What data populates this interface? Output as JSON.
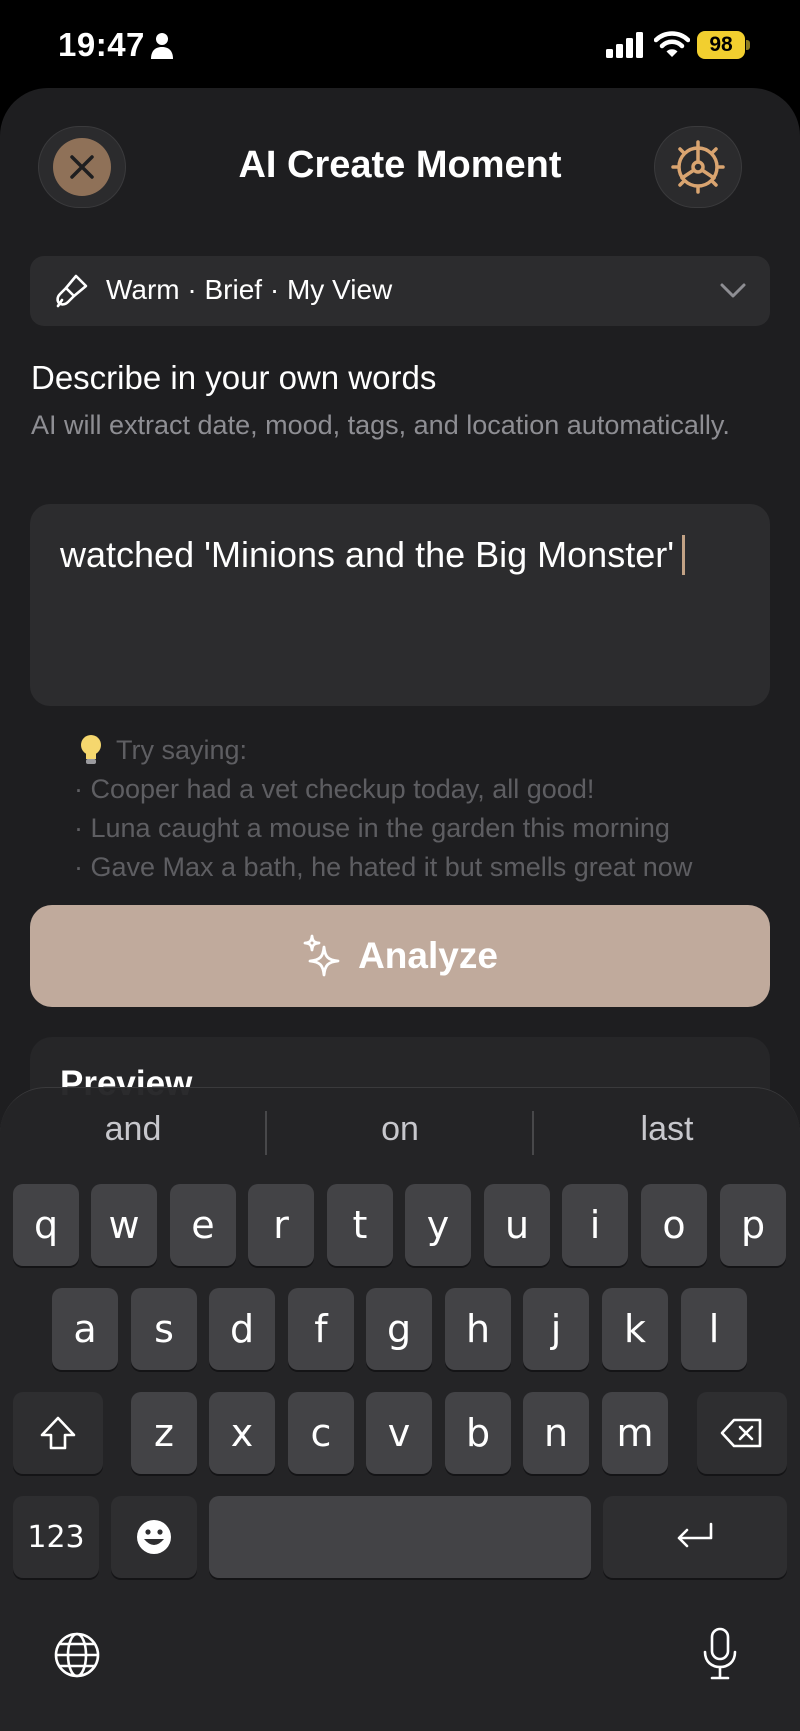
{
  "status_bar": {
    "time": "19:47",
    "battery": "98",
    "icons": [
      "person-icon",
      "signal-icon",
      "wifi-icon",
      "battery-icon"
    ]
  },
  "header": {
    "title": "AI Create Moment",
    "close_icon": "close-icon",
    "settings_icon": "gear-icon"
  },
  "style_selector": {
    "label": "Warm · Brief · My View",
    "icon": "brush-icon"
  },
  "describe": {
    "title": "Describe in your own words",
    "description": "AI will extract date, mood, tags, and location automatically."
  },
  "input": {
    "value": "watched 'Minions and the Big Monster'"
  },
  "tips": {
    "header": "Try saying:",
    "items": [
      "· Cooper had a vet checkup today, all good!",
      "· Luna caught a mouse in the garden this morning",
      "· Gave Max a bath, he hated it but smells great now"
    ]
  },
  "analyze_button": {
    "label": "Analyze"
  },
  "preview": {
    "title": "Preview"
  },
  "keyboard": {
    "suggestions": [
      "and",
      "on",
      "last"
    ],
    "row1": [
      "q",
      "w",
      "e",
      "r",
      "t",
      "y",
      "u",
      "i",
      "o",
      "p"
    ],
    "row2": [
      "a",
      "s",
      "d",
      "f",
      "g",
      "h",
      "j",
      "k",
      "l"
    ],
    "row3": [
      "z",
      "x",
      "c",
      "v",
      "b",
      "n",
      "m"
    ],
    "numbers_key": "123"
  },
  "colors": {
    "accent": "#c0aa9c",
    "close_fill": "#8f7158",
    "gear": "#d9a470",
    "caret": "#c2a285",
    "battery": "#f2cf2f"
  }
}
